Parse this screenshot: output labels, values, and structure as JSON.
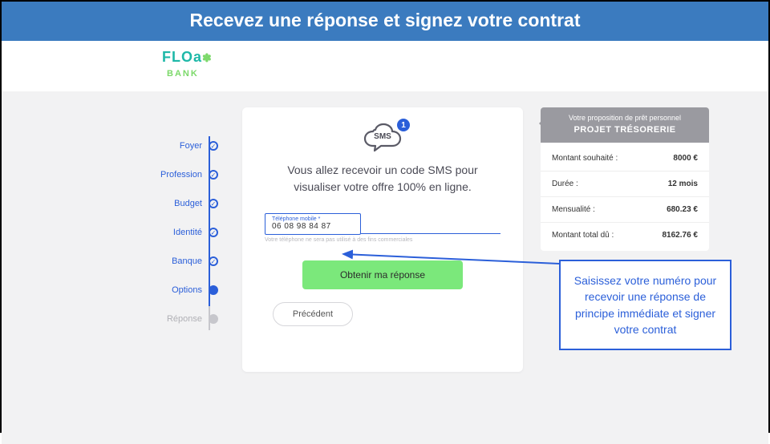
{
  "banner": {
    "title": "Recevez une réponse et signez votre contrat"
  },
  "logo": {
    "name": "FLOa",
    "sub": "BANK"
  },
  "stepper": {
    "items": [
      {
        "label": "Foyer"
      },
      {
        "label": "Profession"
      },
      {
        "label": "Budget"
      },
      {
        "label": "Identité"
      },
      {
        "label": "Banque"
      },
      {
        "label": "Options"
      },
      {
        "label": "Réponse"
      }
    ]
  },
  "card": {
    "sms_label": "SMS",
    "sms_badge": "1",
    "message": "Vous allez recevoir un code SMS pour visualiser votre offre 100% en ligne.",
    "field_label": "Téléphone mobile *",
    "field_value": "06 08 98 84 87",
    "field_hint": "Votre téléphone ne sera pas utilisé à des fins commerciales",
    "submit_label": "Obtenir ma réponse",
    "back_label": "Précédent"
  },
  "sidebar": {
    "subheading": "Votre proposition de prêt personnel",
    "heading": "PROJET TRÉSORERIE",
    "rows": [
      {
        "label": "Montant souhaité :",
        "value": "8000 €"
      },
      {
        "label": "Durée :",
        "value": "12 mois"
      },
      {
        "label": "Mensualité :",
        "value": "680.23 €"
      },
      {
        "label": "Montant total dû :",
        "value": "8162.76 €"
      }
    ]
  },
  "callout": {
    "text": "Saisissez votre numéro pour recevoir une réponse de principe immédiate et signer votre contrat"
  }
}
